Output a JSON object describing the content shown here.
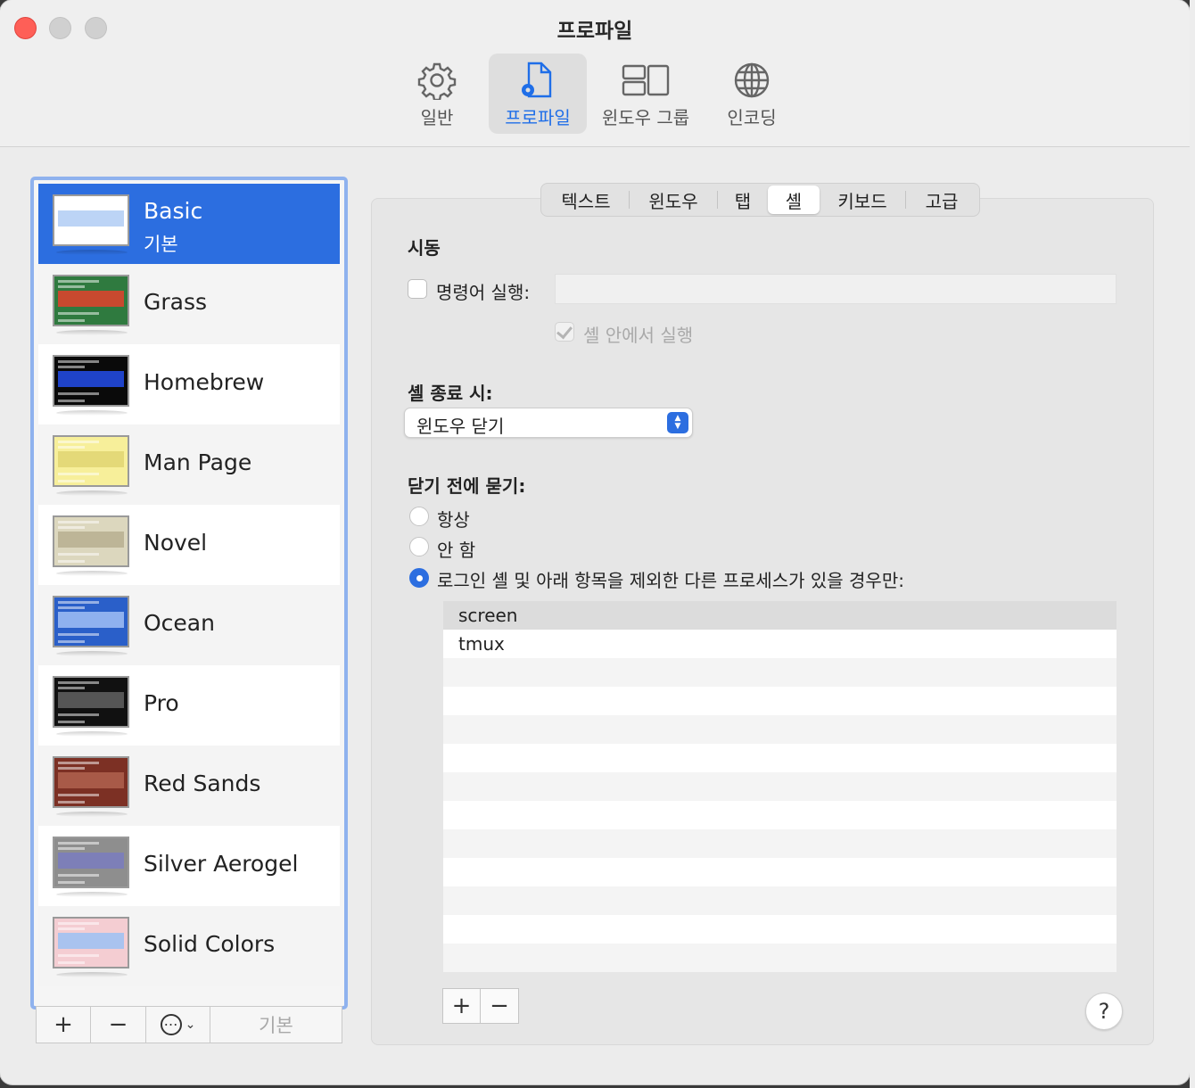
{
  "window": {
    "title": "프로파일"
  },
  "toolbar": {
    "items": [
      {
        "label": "일반",
        "icon": "gear-icon"
      },
      {
        "label": "프로파일",
        "icon": "profile-document-gear-icon"
      },
      {
        "label": "윈도우 그룹",
        "icon": "window-groups-icon"
      },
      {
        "label": "인코딩",
        "icon": "globe-icon"
      }
    ],
    "active": "프로파일"
  },
  "profiles": [
    {
      "name": "Basic",
      "subtitle": "기본",
      "bg": "#ffffff",
      "hl": "#bcd4f6",
      "selected": true
    },
    {
      "name": "Grass",
      "bg": "#2f7a3f",
      "hl": "#c8492f"
    },
    {
      "name": "Homebrew",
      "bg": "#0a0a0a",
      "hl": "#1f43c9"
    },
    {
      "name": "Man Page",
      "bg": "#f7ef9a",
      "hl": "#e4d978"
    },
    {
      "name": "Novel",
      "bg": "#dcd7be",
      "hl": "#bdb597"
    },
    {
      "name": "Ocean",
      "bg": "#2a5fc9",
      "hl": "#8fb1ef"
    },
    {
      "name": "Pro",
      "bg": "#111111",
      "hl": "#555555"
    },
    {
      "name": "Red Sands",
      "bg": "#7c3024",
      "hl": "#a85a48"
    },
    {
      "name": "Silver Aerogel",
      "bg": "#8e8e8e",
      "hl": "#7d7fb8"
    },
    {
      "name": "Solid Colors",
      "bg": "#f4cdd2",
      "hl": "#a9c3ef"
    }
  ],
  "sidebar_buttons": {
    "add": "+",
    "remove": "−",
    "more": "⋯",
    "default": "기본"
  },
  "tabs": [
    "텍스트",
    "윈도우",
    "탭",
    "셸",
    "키보드",
    "고급"
  ],
  "active_tab": "셸",
  "startup": {
    "heading": "시동",
    "run_command_label": "명령어 실행:",
    "run_command_checked": false,
    "run_command_value": "",
    "run_in_shell_label": "셸 안에서 실행",
    "run_in_shell_checked": true
  },
  "shell_exit": {
    "heading": "셸 종료 시:",
    "selected": "윈도우 닫기"
  },
  "ask_before_close": {
    "heading": "닫기 전에 묻기:",
    "options": [
      "항상",
      "안 함",
      "로그인 셸 및 아래 항목을 제외한 다른 프로세스가 있을 경우만:"
    ],
    "selected_index": 2
  },
  "process_list": [
    "screen",
    "tmux"
  ],
  "process_buttons": {
    "add": "+",
    "remove": "−"
  },
  "help": "?",
  "colors": {
    "accent": "#2c6ee0",
    "close": "#fe5f57",
    "sidebar_border": "#8fb2ee"
  }
}
